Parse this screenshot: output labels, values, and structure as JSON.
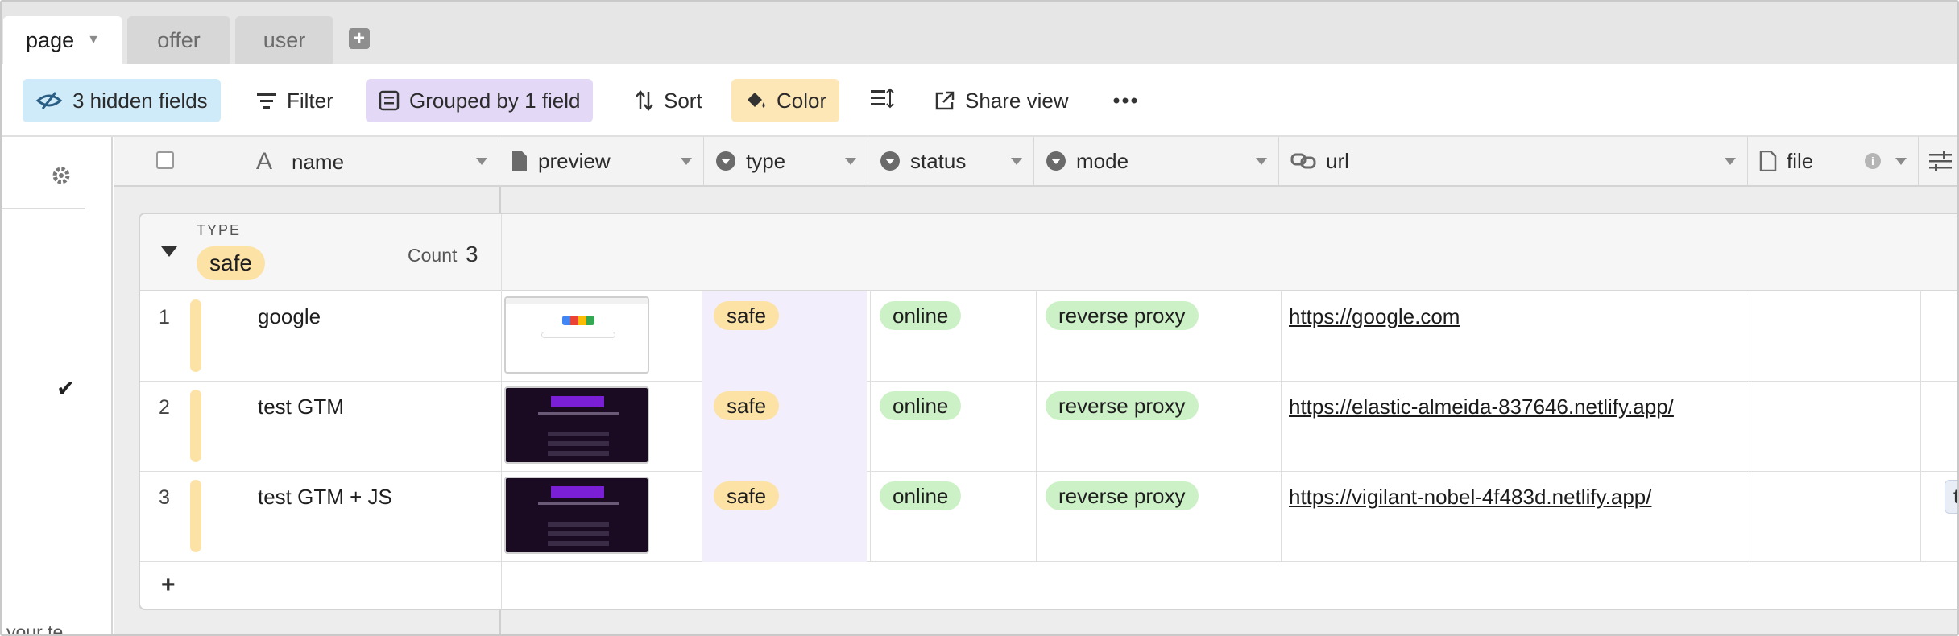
{
  "tabs": [
    {
      "label": "page",
      "active": true
    },
    {
      "label": "offer",
      "active": false
    },
    {
      "label": "user",
      "active": false
    }
  ],
  "toolbar": {
    "hidden_fields": "3 hidden fields",
    "filter": "Filter",
    "grouped": "Grouped by 1 field",
    "sort": "Sort",
    "color": "Color",
    "share": "Share view"
  },
  "left_panel": {
    "snippet": "your te..."
  },
  "columns": [
    {
      "label": "name",
      "icon": "text-icon"
    },
    {
      "label": "preview",
      "icon": "file-icon"
    },
    {
      "label": "type",
      "icon": "single-select-icon"
    },
    {
      "label": "status",
      "icon": "single-select-icon"
    },
    {
      "label": "mode",
      "icon": "single-select-icon"
    },
    {
      "label": "url",
      "icon": "link-icon"
    },
    {
      "label": "file",
      "icon": "file-icon"
    }
  ],
  "group": {
    "field": "TYPE",
    "value": "safe",
    "count_label": "Count",
    "count": "3"
  },
  "rows": [
    {
      "num": "1",
      "name": "google",
      "type": "safe",
      "status": "online",
      "mode": "reverse proxy",
      "url": "https://google.com",
      "file": ""
    },
    {
      "num": "2",
      "name": "test GTM",
      "type": "safe",
      "status": "online",
      "mode": "reverse proxy",
      "url": "https://elastic-almeida-837646.netlify.app/",
      "file": ""
    },
    {
      "num": "3",
      "name": "test GTM + JS",
      "type": "safe",
      "status": "online",
      "mode": "reverse proxy",
      "url": "https://vigilant-nobel-4f483d.netlify.app/",
      "file": "tes"
    }
  ],
  "colors": {
    "safe": "#fde2a6",
    "online": "#cdf1c7",
    "hidden_fields_bg": "#cfeaf9",
    "grouped_bg": "#e3d9f7",
    "color_bg": "#fde7b6"
  }
}
